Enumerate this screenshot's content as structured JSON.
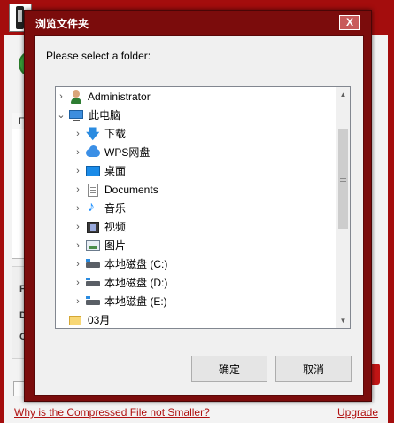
{
  "dialog": {
    "title": "浏览文件夹",
    "close_label": "X",
    "prompt": "Please select a folder:",
    "ok_label": "确定",
    "cancel_label": "取消"
  },
  "tree": {
    "items": [
      {
        "label": "Administrator",
        "icon": "user-icon",
        "level": 0,
        "expanded": false
      },
      {
        "label": "此电脑",
        "icon": "computer-icon",
        "level": 0,
        "expanded": true,
        "selected": true
      },
      {
        "label": "下载",
        "icon": "download-icon",
        "level": 1,
        "expanded": false
      },
      {
        "label": "WPS网盘",
        "icon": "cloud-icon",
        "level": 1,
        "expanded": false
      },
      {
        "label": "桌面",
        "icon": "desktop-icon",
        "level": 1,
        "expanded": false
      },
      {
        "label": "Documents",
        "icon": "document-icon",
        "level": 1,
        "expanded": false
      },
      {
        "label": "音乐",
        "icon": "music-icon",
        "level": 1,
        "expanded": false
      },
      {
        "label": "视频",
        "icon": "video-icon",
        "level": 1,
        "expanded": false
      },
      {
        "label": "图片",
        "icon": "picture-icon",
        "level": 1,
        "expanded": false
      },
      {
        "label": "本地磁盘 (C:)",
        "icon": "drive-icon",
        "level": 1,
        "expanded": false
      },
      {
        "label": "本地磁盘 (D:)",
        "icon": "drive-icon",
        "level": 1,
        "expanded": false
      },
      {
        "label": "本地磁盘 (E:)",
        "icon": "drive-icon",
        "level": 1,
        "expanded": false
      },
      {
        "label": "03月",
        "icon": "folder-icon",
        "level": 0,
        "expanded": false
      }
    ]
  },
  "background_app": {
    "letter_a": "A",
    "file_header": "File",
    "label_pd": "PD",
    "label_dp": "DP",
    "label_co": "Co",
    "link_help": "Why is the Compressed File not Smaller?",
    "link_upgrade": "Upgrade"
  },
  "colors": {
    "title_bar": "#a40d0d",
    "dialog_frame": "#7b0c0c",
    "link": "#b01010",
    "selection": "#cce8ff"
  }
}
